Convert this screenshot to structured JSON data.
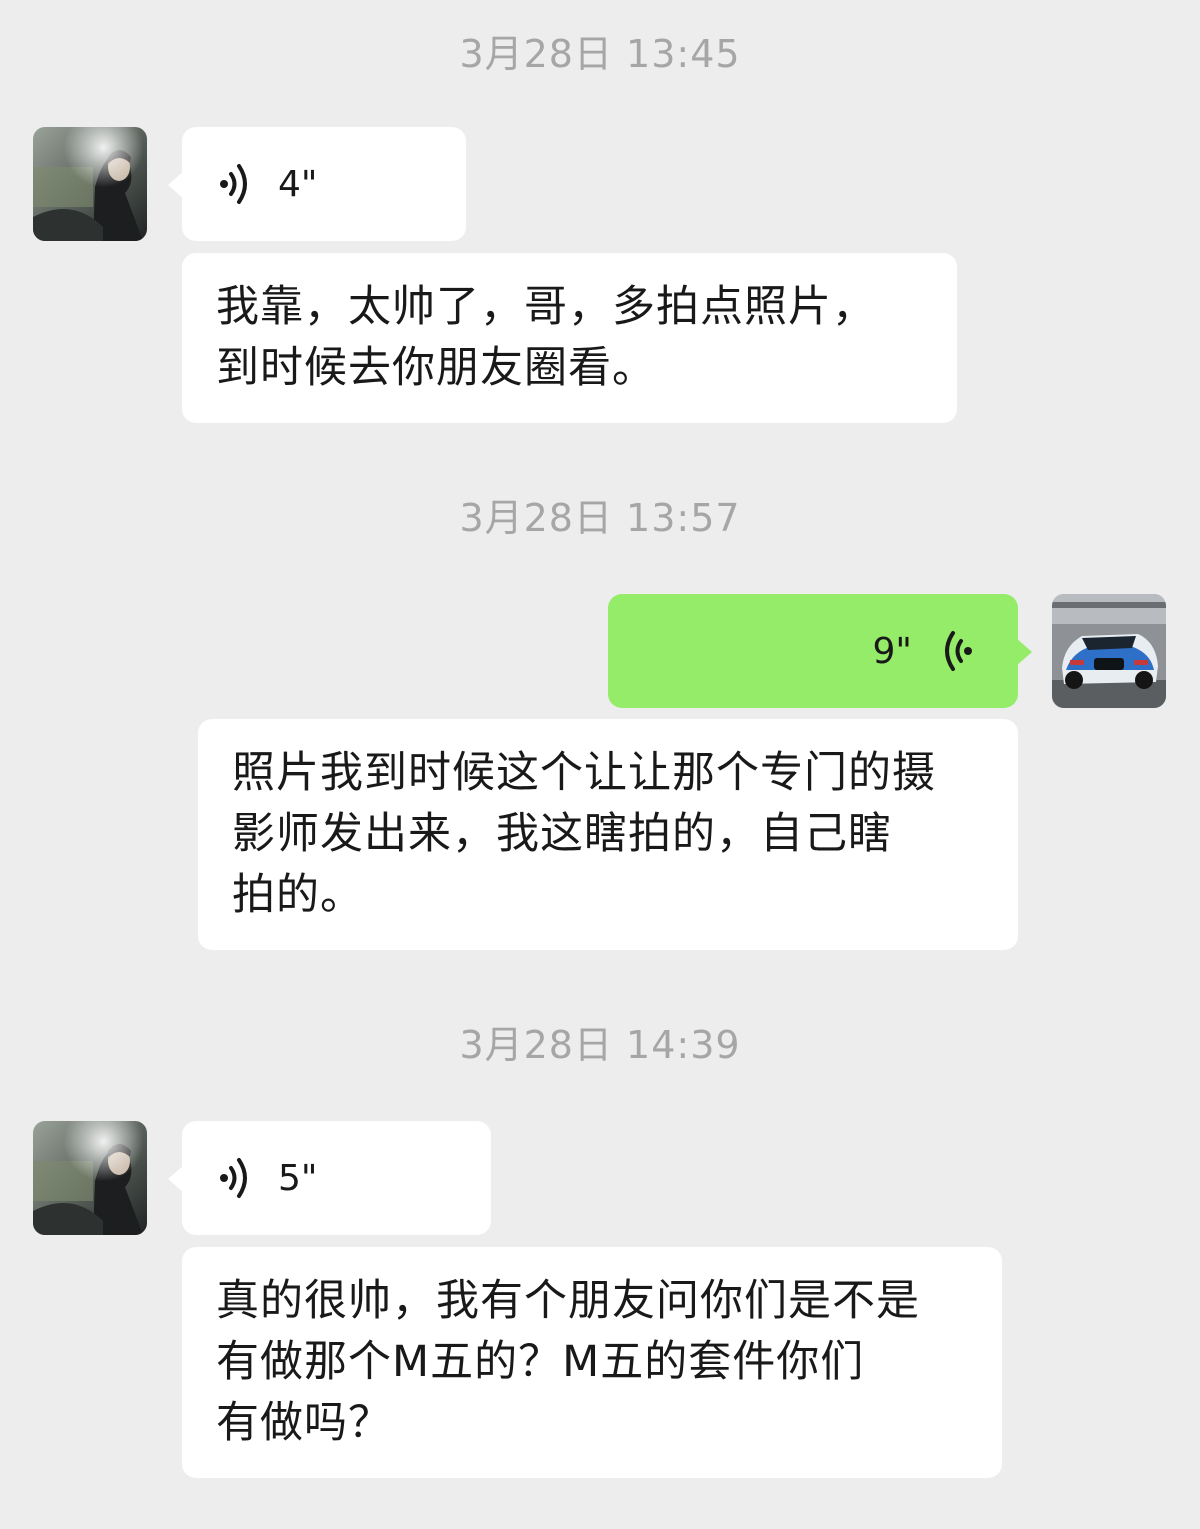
{
  "messages": [
    {
      "type": "timestamp",
      "text": "3月28日 13:45"
    },
    {
      "type": "voice",
      "side": "left",
      "duration": "4\"",
      "avatar": "contact-avatar"
    },
    {
      "type": "text",
      "side": "left",
      "text": "我靠，太帅了，哥，多拍点照片，\n到时候去你朋友圈看。"
    },
    {
      "type": "timestamp",
      "text": "3月28日 13:57"
    },
    {
      "type": "voice",
      "side": "right",
      "duration": "9\"",
      "avatar": "self-avatar-race-car"
    },
    {
      "type": "text",
      "side": "right",
      "text": "照片我到时候这个让让那个专门的摄\n影师发出来，我这瞎拍的，自己瞎\n拍的。"
    },
    {
      "type": "timestamp",
      "text": "3月28日 14:39"
    },
    {
      "type": "voice",
      "side": "left",
      "duration": "5\"",
      "avatar": "contact-avatar"
    },
    {
      "type": "text",
      "side": "left",
      "text": "真的很帅，我有个朋友问你们是不是\n有做那个M五的？M五的套件你们\n有做吗？"
    }
  ],
  "colors": {
    "background": "#ededed",
    "incoming_bubble": "#ffffff",
    "outgoing_bubble": "#95ec69",
    "timestamp_text": "#a6a6a6",
    "message_text": "#191919"
  },
  "icons": {
    "incoming_voice": "voice-wave-icon",
    "outgoing_voice": "voice-wave-icon"
  }
}
